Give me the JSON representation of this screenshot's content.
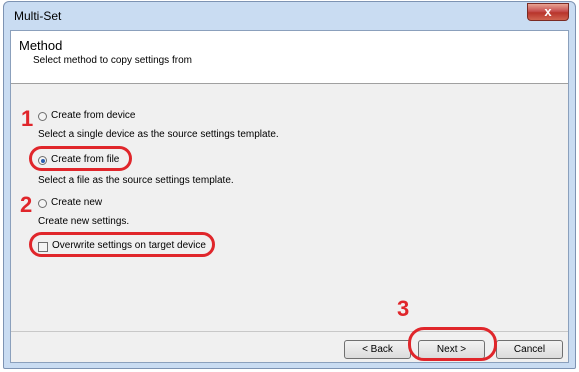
{
  "window": {
    "title": "Multi-Set",
    "close_label": "x"
  },
  "header": {
    "title": "Method",
    "subtitle": "Select method to copy settings from"
  },
  "options": [
    {
      "label": "Create from device",
      "description": "Select a single device as the source settings template.",
      "checked": false
    },
    {
      "label": "Create from file",
      "description": "Select a file as the source settings template.",
      "checked": true
    },
    {
      "label": "Create new",
      "description": "Create new settings.",
      "checked": false
    }
  ],
  "checkbox": {
    "label": "Overwrite settings on target device",
    "checked": false
  },
  "buttons": {
    "back": "< Back",
    "next": "Next >",
    "cancel": "Cancel"
  },
  "steps": [
    "1",
    "2",
    "3"
  ],
  "colors": {
    "annotation": "#e0262b",
    "title_bar": "#c9dcf2"
  }
}
